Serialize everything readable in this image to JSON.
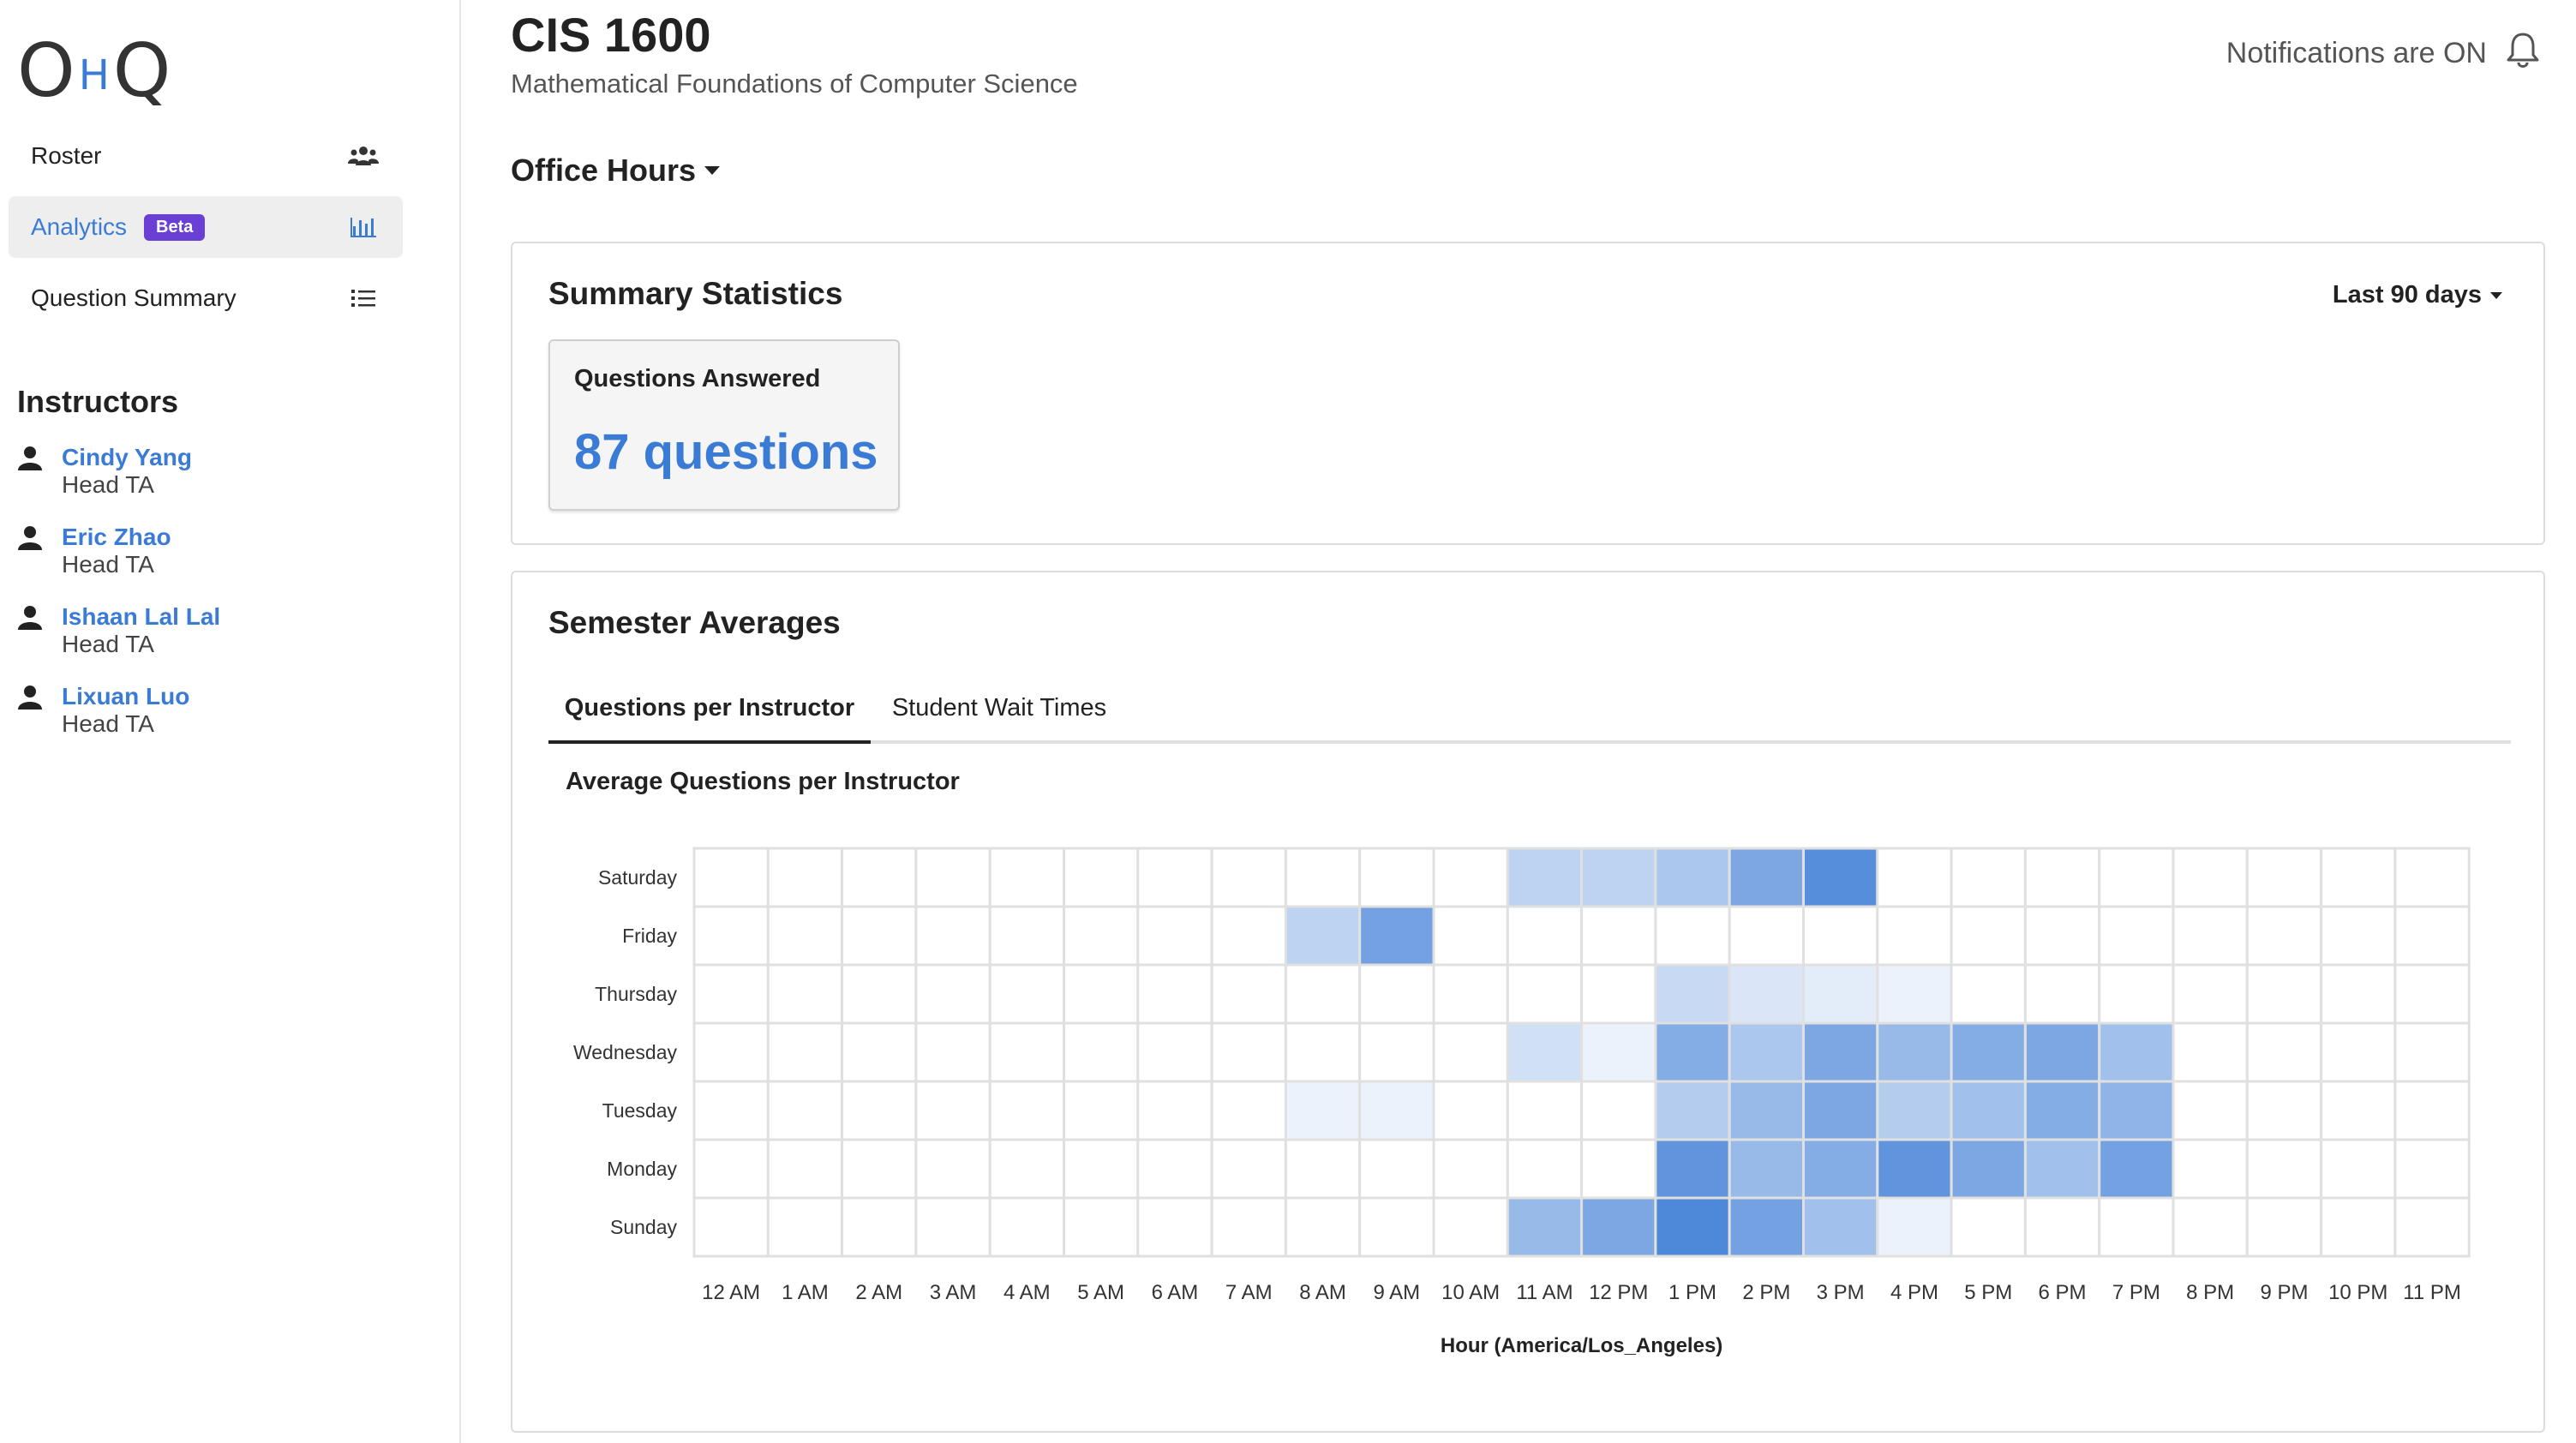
{
  "logo": {
    "left": "O",
    "middle": "H",
    "right": "Q"
  },
  "sidebar": {
    "items": [
      {
        "label": "Roster",
        "icon": "users-icon"
      },
      {
        "label": "Analytics",
        "badge": "Beta",
        "icon": "bar-chart-icon",
        "active": true
      },
      {
        "label": "Question Summary",
        "icon": "list-icon"
      }
    ],
    "instructors_heading": "Instructors",
    "instructors": [
      {
        "name": "Cindy Yang",
        "role": "Head TA"
      },
      {
        "name": "Eric Zhao",
        "role": "Head TA"
      },
      {
        "name": "Ishaan Lal Lal",
        "role": "Head TA"
      },
      {
        "name": "Lixuan Luo",
        "role": "Head TA"
      }
    ]
  },
  "header": {
    "course_code": "CIS 1600",
    "course_name": "Mathematical Foundations of Computer Science",
    "notifications": "Notifications are ON",
    "queue_select": "Office Hours"
  },
  "summary": {
    "title": "Summary Statistics",
    "range": "Last 90 days",
    "stat_label": "Questions Answered",
    "stat_value": "87 questions"
  },
  "averages": {
    "title": "Semester Averages",
    "tabs": [
      {
        "label": "Questions per Instructor",
        "active": true
      },
      {
        "label": "Student Wait Times",
        "active": false
      }
    ],
    "chart_title": "Average Questions per Instructor"
  },
  "colors": {
    "accent": "#3a7bd5",
    "badge": "#6a3fd6",
    "heat_max": "#3a7bd5"
  },
  "chart_data": {
    "type": "heatmap",
    "title": "Average Questions per Instructor",
    "xlabel": "Hour (America/Los_Angeles)",
    "ylabel": "",
    "x": [
      "12 AM",
      "1 AM",
      "2 AM",
      "3 AM",
      "4 AM",
      "5 AM",
      "6 AM",
      "7 AM",
      "8 AM",
      "9 AM",
      "10 AM",
      "11 AM",
      "12 PM",
      "1 PM",
      "2 PM",
      "3 PM",
      "4 PM",
      "5 PM",
      "6 PM",
      "7 PM",
      "8 PM",
      "9 PM",
      "10 PM",
      "11 PM"
    ],
    "y": [
      "Saturday",
      "Friday",
      "Thursday",
      "Wednesday",
      "Tuesday",
      "Monday",
      "Sunday"
    ],
    "values": [
      [
        0,
        0,
        0,
        0,
        0,
        0,
        0,
        0,
        0,
        0,
        0,
        0.35,
        0.35,
        0.45,
        0.7,
        0.9,
        0,
        0,
        0,
        0,
        0,
        0,
        0,
        0
      ],
      [
        0,
        0,
        0,
        0,
        0,
        0,
        0,
        0,
        0.35,
        0.75,
        0,
        0,
        0,
        0,
        0,
        0,
        0,
        0,
        0,
        0,
        0,
        0,
        0,
        0
      ],
      [
        0,
        0,
        0,
        0,
        0,
        0,
        0,
        0,
        0,
        0,
        0,
        0,
        0,
        0.3,
        0.2,
        0.15,
        0.1,
        0,
        0,
        0,
        0,
        0,
        0,
        0
      ],
      [
        0,
        0,
        0,
        0,
        0,
        0,
        0,
        0,
        0,
        0,
        0,
        0.25,
        0.1,
        0.65,
        0.45,
        0.7,
        0.55,
        0.65,
        0.7,
        0.5,
        0,
        0,
        0,
        0
      ],
      [
        0,
        0,
        0,
        0,
        0,
        0,
        0,
        0,
        0.1,
        0.1,
        0,
        0,
        0,
        0.4,
        0.55,
        0.7,
        0.4,
        0.5,
        0.65,
        0.6,
        0,
        0,
        0,
        0
      ],
      [
        0,
        0,
        0,
        0,
        0,
        0,
        0,
        0,
        0,
        0,
        0,
        0,
        0,
        0.85,
        0.55,
        0.65,
        0.85,
        0.7,
        0.5,
        0.75,
        0,
        0,
        0,
        0
      ],
      [
        0,
        0,
        0,
        0,
        0,
        0,
        0,
        0,
        0,
        0,
        0,
        0.55,
        0.7,
        0.95,
        0.75,
        0.5,
        0.1,
        0,
        0,
        0,
        0,
        0,
        0,
        0
      ]
    ],
    "grid": true
  }
}
